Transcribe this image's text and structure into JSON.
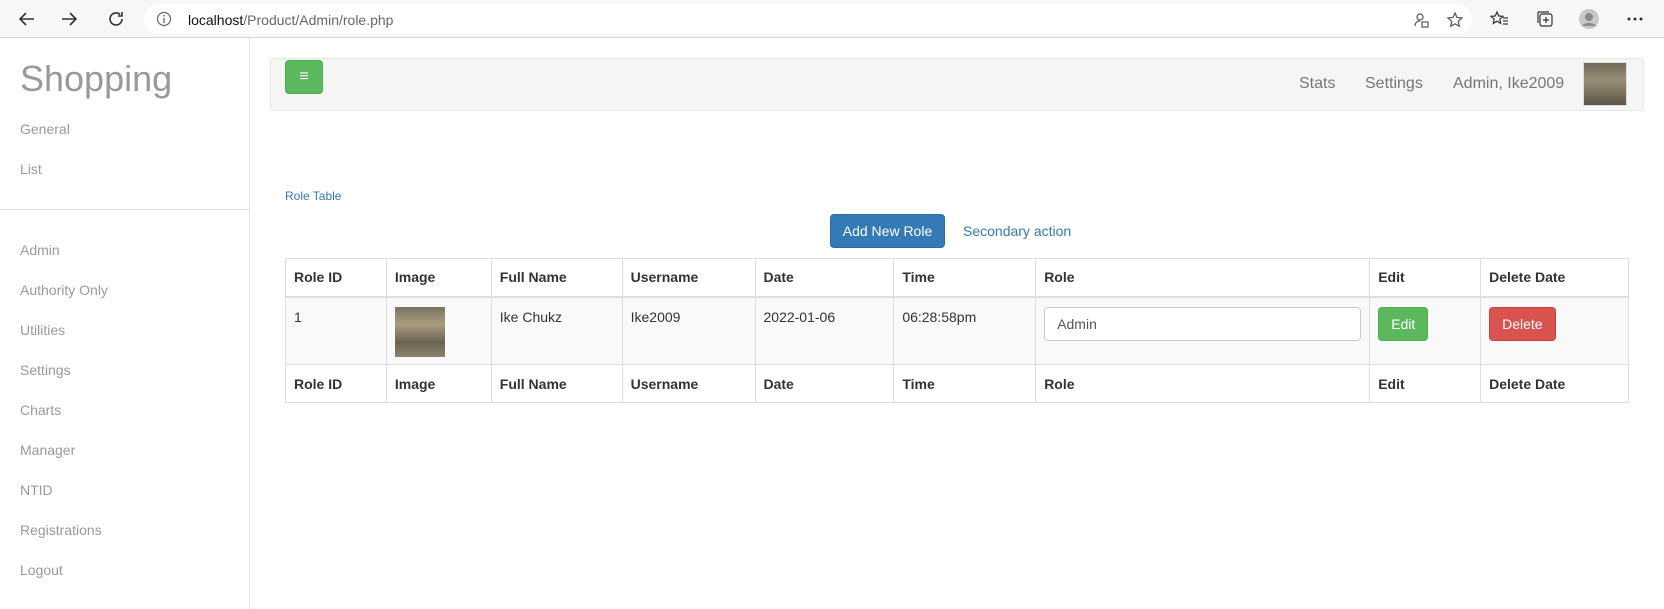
{
  "browser": {
    "url_host": "localhost",
    "url_path": "/Product/Admin/role.php"
  },
  "sidebar": {
    "brand": "Shopping",
    "items": [
      {
        "label": "General"
      },
      {
        "label": "List"
      },
      {
        "label": "Admin"
      },
      {
        "label": " Authority Only"
      },
      {
        "label": " Utilities"
      },
      {
        "label": " Settings"
      },
      {
        "label": "Charts"
      },
      {
        "label": "Manager"
      },
      {
        "label": "NTID"
      },
      {
        "label": "Registrations"
      },
      {
        "label": "Logout"
      }
    ]
  },
  "topnav": {
    "menu_icon": "≡",
    "stats": "Stats",
    "settings": "Settings",
    "user": "Admin, Ike2009"
  },
  "main": {
    "section_label": "Role Table",
    "add_button": "Add New Role",
    "secondary_action": "Secondary action"
  },
  "table": {
    "columns": [
      "Role ID",
      "Image",
      "Full Name",
      "Username",
      "Date",
      "Time",
      "Role",
      "Edit",
      "Delete Date"
    ],
    "rows": [
      {
        "role_id": "1",
        "full_name": "Ike Chukz",
        "username": "Ike2009",
        "date": "2022-01-06",
        "time": "06:28:58pm",
        "role": "Admin",
        "edit_label": "Edit",
        "delete_label": "Delete"
      }
    ]
  },
  "colors": {
    "primary": "#337ab7",
    "success": "#5cb85c",
    "danger": "#d9534f"
  }
}
